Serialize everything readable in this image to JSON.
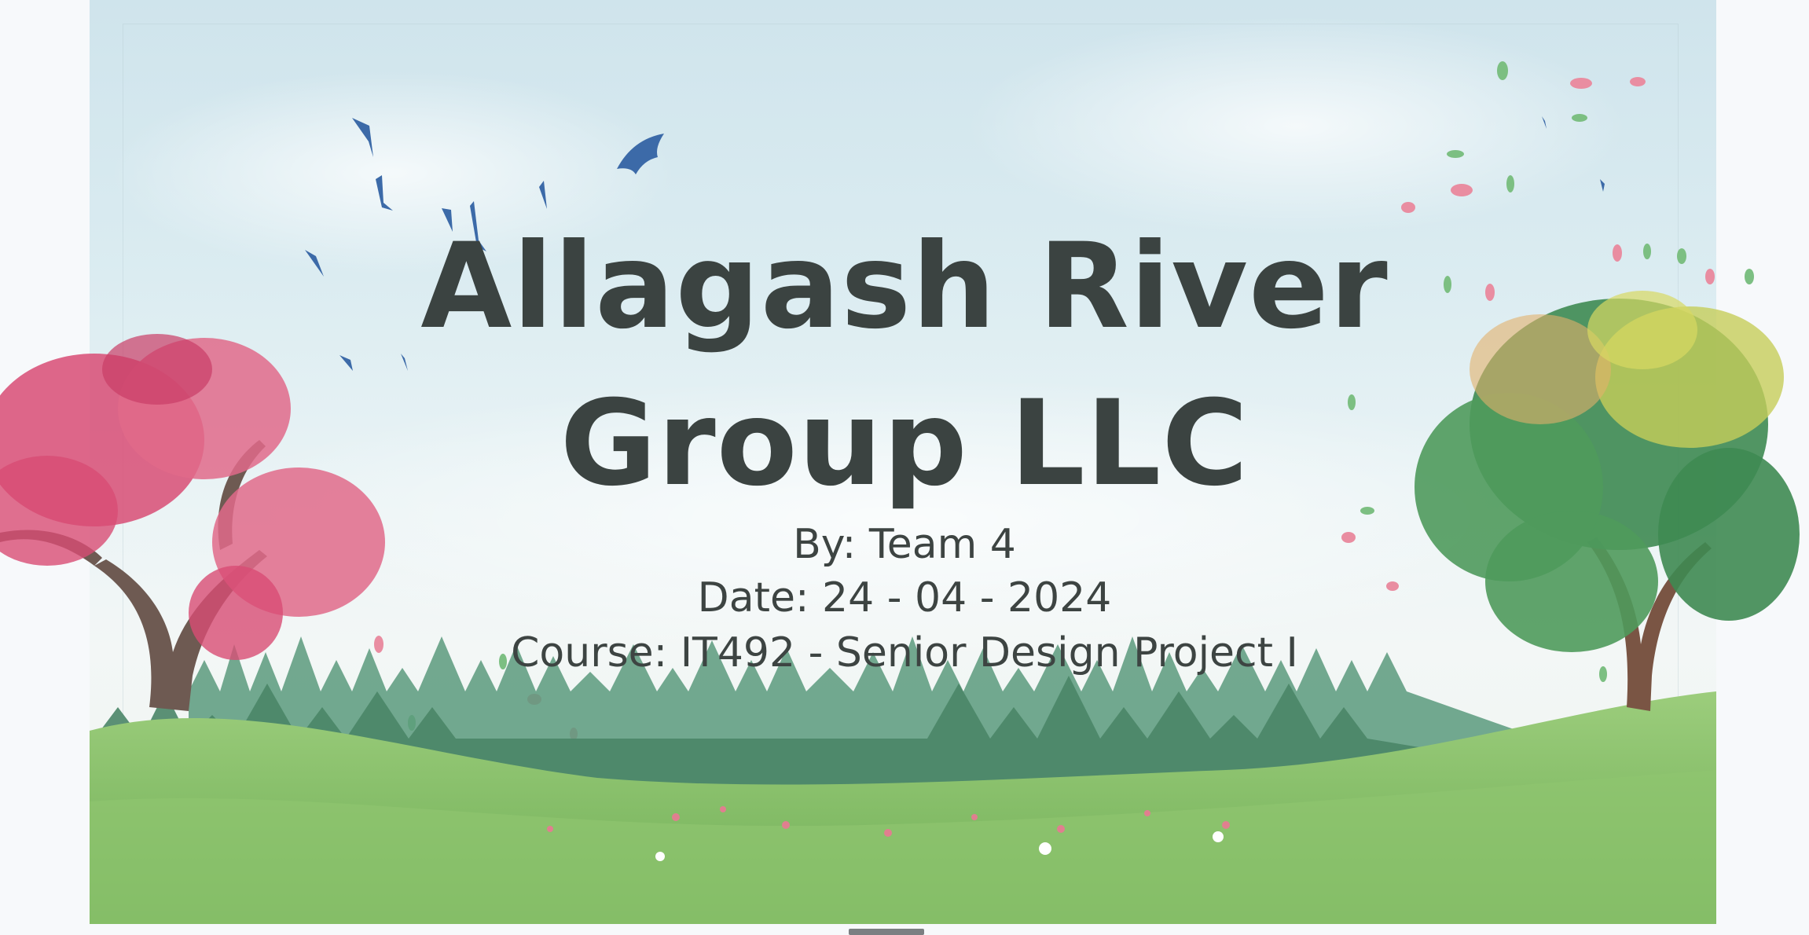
{
  "slide": {
    "title_line1": "Allagash River",
    "title_line2": "Group LLC",
    "byline": "By: Team 4",
    "date": "Date: 24 - 04 - 2024",
    "course": "Course: IT492 - Senior Design Project I"
  },
  "colors": {
    "title_text": "#3b4341",
    "sky": "#d6e9ef",
    "blossom": "#d84c74",
    "foliage": "#3e8a52",
    "grass": "#7cbc63",
    "forest": "#4f8a6e",
    "bird": "#3c6aa8"
  },
  "icons": [
    "bird-icon",
    "cherry-blossom-tree",
    "green-tree",
    "pine-forest",
    "meadow-grass",
    "falling-petal"
  ]
}
